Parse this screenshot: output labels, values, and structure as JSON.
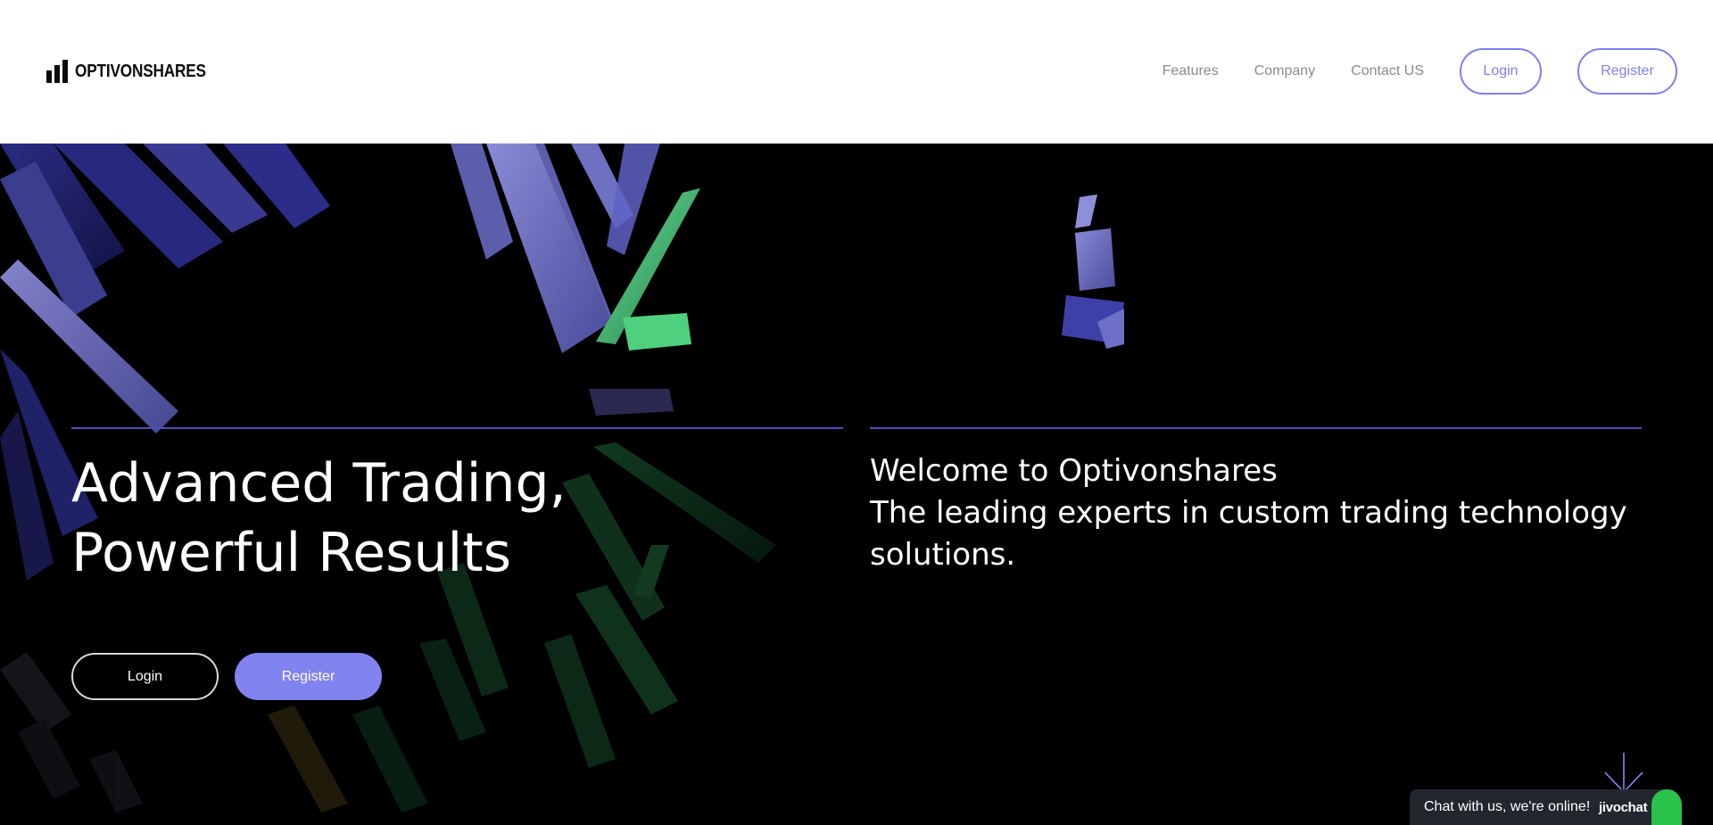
{
  "header": {
    "brand": "OPTIVONSHARES",
    "nav": [
      "Features",
      "Company",
      "Contact US"
    ],
    "login_label": "Login",
    "register_label": "Register"
  },
  "hero": {
    "headline_line1": "Advanced Trading,",
    "headline_line2": "Powerful Results",
    "welcome_line1": "Welcome to Optivonshares",
    "welcome_line2": "The leading experts in custom trading technology solutions.",
    "login_label": "Login",
    "register_label": "Register"
  },
  "chat": {
    "text": "Chat with us, we're online!",
    "brand": "jivochat"
  },
  "colors": {
    "accent": "#7e80f0",
    "button_fill": "#8183ee",
    "divider": "#4e50b8",
    "chat_bg": "#23262d",
    "chat_green": "#29c24b"
  },
  "icons": [
    "logo-bars-icon",
    "scroll-down-arrow-icon",
    "chat-bubble-icon"
  ]
}
